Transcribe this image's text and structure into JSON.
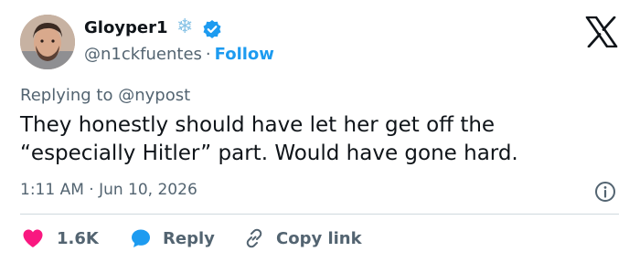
{
  "user": {
    "display_name": "Gloyper1",
    "handle": "@n1ckfuentes",
    "separator": "·",
    "follow_label": "Follow",
    "badge_emoji": "❄",
    "verified": true
  },
  "reply_context": {
    "prefix": "Replying to",
    "target": "@nypost"
  },
  "tweet": {
    "text": "They honestly should have let her get off the “especially Hitler” part. Would have gone hard.",
    "timestamp": "1:11 AM · Jun 10, 2026"
  },
  "actions": {
    "like_count": "1.6K",
    "reply_label": "Reply",
    "copy_link_label": "Copy link"
  },
  "icons": {
    "logo": "x-logo-icon",
    "verified": "verified-badge-icon",
    "info": "info-icon",
    "like": "heart-icon",
    "reply": "chat-bubble-icon",
    "copy": "link-icon"
  },
  "colors": {
    "accent": "#1d9bf0",
    "like": "#f91880",
    "muted_text": "#536471",
    "text": "#0f1419",
    "divider": "#cfd9de"
  }
}
